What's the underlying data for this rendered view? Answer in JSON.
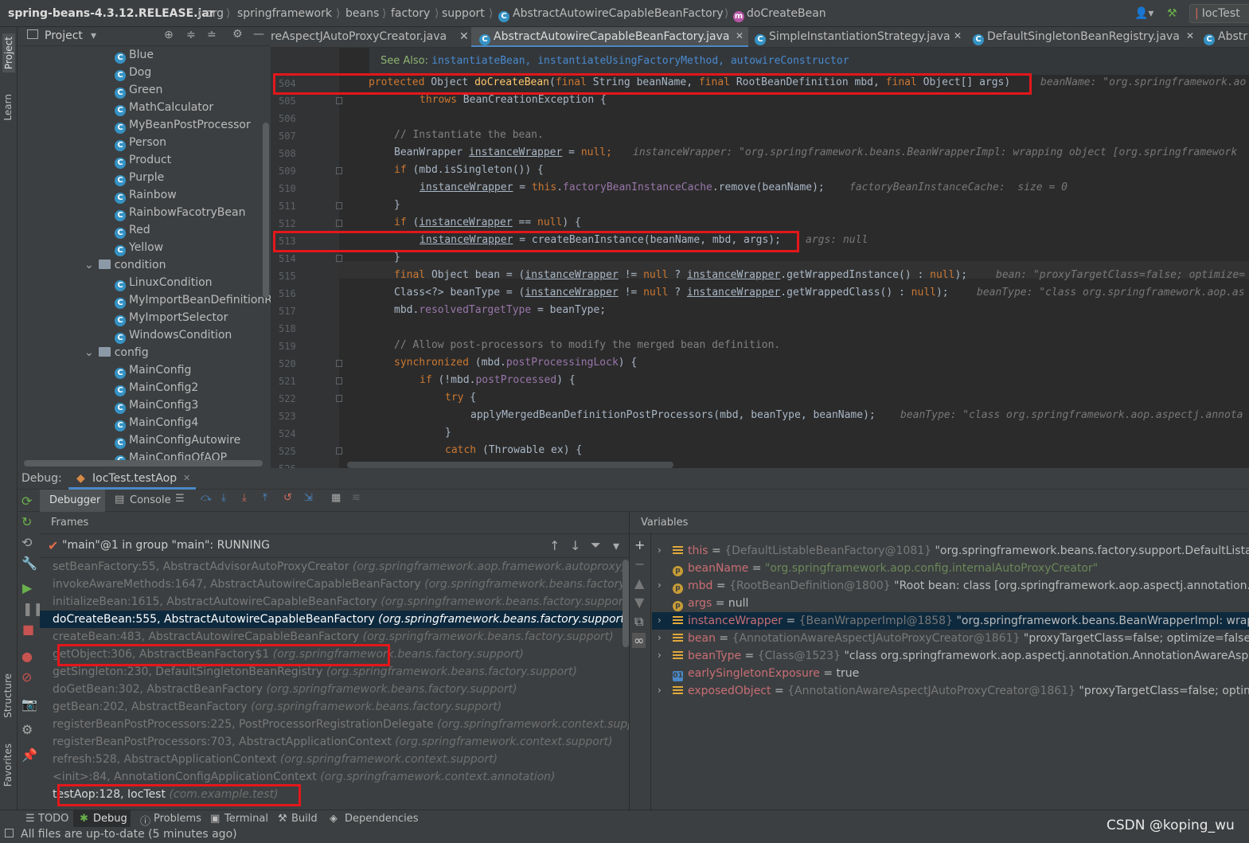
{
  "breadcrumb": {
    "jar": "spring-beans-4.3.12.RELEASE.jar",
    "parts": [
      "org",
      "springframework",
      "beans",
      "factory",
      "support"
    ],
    "class": "AbstractAutowireCapableBeanFactory",
    "method": "doCreateBean",
    "run_config": "IocTest"
  },
  "left_strip": {
    "project": "Project",
    "learn": "Learn",
    "structure": "Structure",
    "favorites": "Favorites"
  },
  "project": {
    "title": "Project",
    "items": [
      "Blue",
      "Dog",
      "Green",
      "MathCalculator",
      "MyBeanPostProcessor",
      "Person",
      "Product",
      "Purple",
      "Rainbow",
      "RainbowFacotryBean",
      "Red",
      "Yellow"
    ],
    "condition_folder": "condition",
    "condition_items": [
      "LinuxCondition",
      "MyImportBeanDefinitionRegistrar",
      "MyImportSelector",
      "WindowsCondition"
    ],
    "config_folder": "config",
    "config_items": [
      "MainConfig",
      "MainConfig2",
      "MainConfig3",
      "MainConfig4",
      "MainConfigAutowire",
      "MainConfigOfAOP"
    ]
  },
  "editor": {
    "tabs": [
      "reAspectJAutoProxyCreator.java",
      "AbstractAutowireCapableBeanFactory.java",
      "SimpleInstantiationStrategy.java",
      "DefaultSingletonBeanRegistry.java",
      "Abstr"
    ],
    "see_also_label": "See Also:",
    "see_also": "instantiateBean, instantiateUsingFactoryMethod, autowireConstructor",
    "lines": [
      "504",
      "505",
      "506",
      "507",
      "508",
      "509",
      "510",
      "511",
      "512",
      "513",
      "514",
      "515",
      "516",
      "517",
      "518",
      "519",
      "520",
      "521",
      "522",
      "523",
      "524",
      "525",
      "526"
    ],
    "code": {
      "l504a": "protected",
      "l504b": " Object ",
      "l504c": "doCreateBean",
      "l504d": "(",
      "l504e": "final",
      "l504f": " String beanName, ",
      "l504g": "final",
      "l504h": " RootBeanDefinition mbd, ",
      "l504i": "final",
      "l504j": " Object[] args)",
      "h504": "beanName: \"org.springframework.ao",
      "l505a": "throws",
      "l505b": " BeanCreationException {",
      "l507": "// Instantiate the bean.",
      "l508a": "BeanWrapper ",
      "l508b": "instanceWrapper",
      "l508c": " = ",
      "l508d": "null",
      "l508e": ";",
      "h508": "instanceWrapper: \"org.springframework.beans.BeanWrapperImpl: wrapping object [org.springframework",
      "l509a": "if",
      "l509b": " (mbd.isSingleton()) {",
      "l510a": "instanceWrapper",
      "l510b": " = ",
      "l510c": "this",
      "l510d": ".",
      "l510e": "factoryBeanInstanceCache",
      "l510f": ".remove(beanName);",
      "h510": "factoryBeanInstanceCache:  size = 0",
      "l511": "}",
      "l512a": "if",
      "l512b": " (",
      "l512c": "instanceWrapper",
      "l512d": " == ",
      "l512e": "null",
      "l512f": ") {",
      "l513a": "instanceWrapper",
      "l513b": " = createBeanInstance(beanName, mbd, args);",
      "h513": "args: null",
      "l514": "}",
      "l515a": "final",
      "l515b": " Object bean = (",
      "l515c": "instanceWrapper",
      "l515d": " != ",
      "l515e": "null",
      "l515f": " ? ",
      "l515g": "instanceWrapper",
      "l515h": ".getWrappedInstance() : ",
      "l515i": "null",
      "l515j": ");",
      "h515": "bean: \"proxyTargetClass=false; optimize=",
      "l516a": "Class<?> beanType = (",
      "l516b": "instanceWrapper",
      "l516c": " != ",
      "l516d": "null",
      "l516e": " ? ",
      "l516f": "instanceWrapper",
      "l516g": ".getWrappedClass() : ",
      "l516h": "null",
      "l516i": ");",
      "h516": "beanType: \"class org.springframework.aop.as",
      "l517a": "mbd.",
      "l517b": "resolvedTargetType",
      "l517c": " = beanType;",
      "l519": "// Allow post-processors to modify the merged bean definition.",
      "l520a": "synchronized",
      "l520b": " (mbd.",
      "l520c": "postProcessingLock",
      "l520d": ") {",
      "l521a": "if",
      "l521b": " (!mbd.",
      "l521c": "postProcessed",
      "l521d": ") {",
      "l522a": "try",
      "l522b": " {",
      "l523": "applyMergedBeanDefinitionPostProcessors(mbd, beanType, beanName);",
      "h523": "beanType: \"class org.springframework.aop.aspectj.annota",
      "l524": "}",
      "l525a": "catch",
      "l525b": " (Throwable ex) {"
    }
  },
  "debug": {
    "label": "Debug:",
    "session": "IocTest.testAop",
    "debugger_tab": "Debugger",
    "console_tab": "Console",
    "frames_title": "Frames",
    "thread": "\"main\"@1 in group \"main\": RUNNING",
    "frames": [
      {
        "m": "setBeanFactory:55, AbstractAdvisorAutoProxyCreator",
        "p": " (org.springframework.aop.framework.autoproxy)"
      },
      {
        "m": "invokeAwareMethods:1647, AbstractAutowireCapableBeanFactory",
        "p": " (org.springframework.beans.factory.sup"
      },
      {
        "m": "initializeBean:1615, AbstractAutowireCapableBeanFactory",
        "p": " (org.springframework.beans.factory.support)"
      },
      {
        "m": "doCreateBean:555, AbstractAutowireCapableBeanFactory",
        "p": " (org.springframework.beans.factory.support)"
      },
      {
        "m": "createBean:483, AbstractAutowireCapableBeanFactory",
        "p": " (org.springframework.beans.factory.support)"
      },
      {
        "m": "getObject:306, AbstractBeanFactory$1",
        "p": " (org.springframework.beans.factory.support)"
      },
      {
        "m": "getSingleton:230, DefaultSingletonBeanRegistry",
        "p": " (org.springframework.beans.factory.support)"
      },
      {
        "m": "doGetBean:302, AbstractBeanFactory",
        "p": " (org.springframework.beans.factory.support)"
      },
      {
        "m": "getBean:202, AbstractBeanFactory",
        "p": " (org.springframework.beans.factory.support)"
      },
      {
        "m": "registerBeanPostProcessors:225, PostProcessorRegistrationDelegate",
        "p": " (org.springframework.context.suppor"
      },
      {
        "m": "registerBeanPostProcessors:703, AbstractApplicationContext",
        "p": " (org.springframework.context.support)"
      },
      {
        "m": "refresh:528, AbstractApplicationContext",
        "p": " (org.springframework.context.support)"
      },
      {
        "m": "<init>:84, AnnotationConfigApplicationContext",
        "p": " (org.springframework.context.annotation)"
      },
      {
        "m": "testAop:128, IocTest",
        "p": " (com.example.test)"
      }
    ],
    "vars_title": "Variables",
    "vars": [
      {
        "n": "this",
        "ref": "{DefaultListableBeanFactory@1081}",
        "v": " \"org.springframework.beans.factory.support.DefaultListable"
      },
      {
        "n": "beanName",
        "ref": "",
        "v": "\"org.springframework.aop.config.internalAutoProxyCreator\""
      },
      {
        "n": "mbd",
        "ref": "{RootBeanDefinition@1800}",
        "v": " \"Root bean: class [org.springframework.aop.aspectj.annotation.Ann"
      },
      {
        "n": "args",
        "ref": "",
        "v": "null"
      },
      {
        "n": "instanceWrapper",
        "ref": "{BeanWrapperImpl@1858}",
        "v": " \"org.springframework.beans.BeanWrapperImpl: wrappin"
      },
      {
        "n": "bean",
        "ref": "{AnnotationAwareAspectJAutoProxyCreator@1861}",
        "v": " \"proxyTargetClass=false; optimize=false; op"
      },
      {
        "n": "beanType",
        "ref": "{Class@1523}",
        "v": " \"class org.springframework.aop.aspectj.annotation.AnnotationAwareAspectJ"
      },
      {
        "n": "earlySingletonExposure",
        "ref": "",
        "v": "true"
      },
      {
        "n": "exposedObject",
        "ref": "{AnnotationAwareAspectJAutoProxyCreator@1861}",
        "v": " \"proxyTargetClass=false; optimize"
      }
    ]
  },
  "bottom_tabs": [
    "TODO",
    "Debug",
    "Problems",
    "Terminal",
    "Build",
    "Dependencies"
  ],
  "status": "All files are up-to-date (5 minutes ago)",
  "watermark": "CSDN @koping_wu",
  "colors": {
    "highlight_red": "#e3171b",
    "selection": "#0d293e"
  }
}
